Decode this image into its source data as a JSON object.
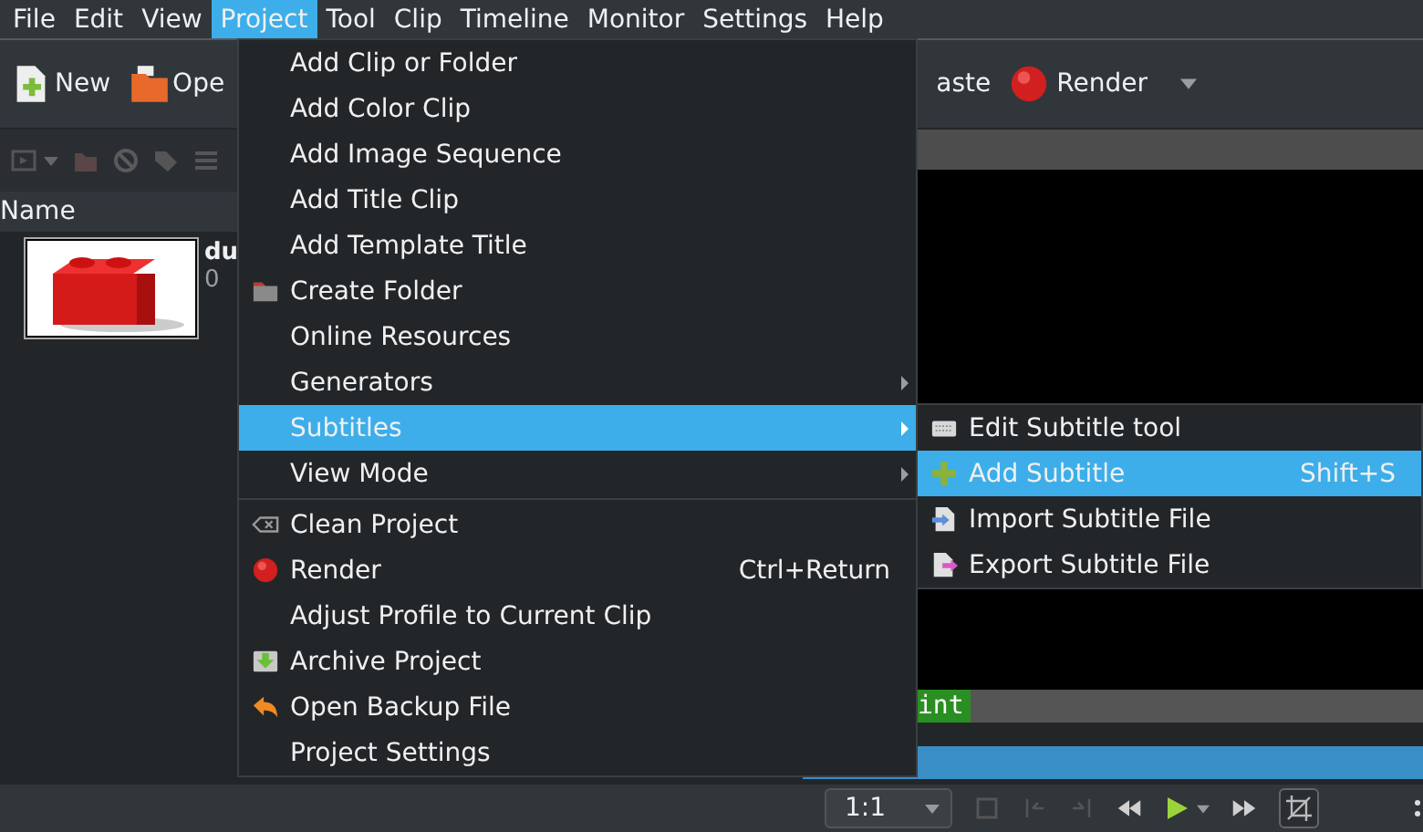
{
  "menubar": [
    {
      "label": "File",
      "selected": false
    },
    {
      "label": "Edit",
      "selected": false
    },
    {
      "label": "View",
      "selected": false
    },
    {
      "label": "Project",
      "selected": true
    },
    {
      "label": "Tool",
      "selected": false
    },
    {
      "label": "Clip",
      "selected": false
    },
    {
      "label": "Timeline",
      "selected": false
    },
    {
      "label": "Monitor",
      "selected": false
    },
    {
      "label": "Settings",
      "selected": false
    },
    {
      "label": "Help",
      "selected": false
    }
  ],
  "toolbar": [
    {
      "label": "New"
    },
    {
      "label": "Ope"
    }
  ],
  "toolbar_right": [
    {
      "label": "aste"
    },
    {
      "label": "Render",
      "dropdown": true
    }
  ],
  "bin": {
    "column_header": "Name",
    "clip": {
      "title": "du",
      "subtitle": "0"
    }
  },
  "project_menu": [
    {
      "label": "Add Clip or Folder",
      "kind": "plain",
      "selected": false
    },
    {
      "label": "Add Color Clip",
      "kind": "plain",
      "selected": false
    },
    {
      "label": "Add Image Sequence",
      "kind": "plain",
      "selected": false
    },
    {
      "label": "Add Title Clip",
      "kind": "plain",
      "selected": false
    },
    {
      "label": "Add Template Title",
      "kind": "plain",
      "selected": false
    },
    {
      "label": "Create Folder",
      "kind": "folder",
      "selected": false
    },
    {
      "label": "Online Resources",
      "kind": "plain",
      "selected": false
    },
    {
      "label": "Generators",
      "kind": "plain",
      "submenu": true,
      "selected": false
    },
    {
      "label": "Subtitles",
      "kind": "plain",
      "submenu": true,
      "selected": true
    },
    {
      "label": "View Mode",
      "kind": "plain",
      "submenu": true,
      "selected": false,
      "separator_after": true
    },
    {
      "label": "Clean Project",
      "kind": "eraser",
      "selected": false
    },
    {
      "label": "Render",
      "kind": "render",
      "shortcut": "Ctrl+Return",
      "selected": false
    },
    {
      "label": "Adjust Profile to Current Clip",
      "kind": "plain",
      "selected": false
    },
    {
      "label": "Archive Project",
      "kind": "archive",
      "selected": false
    },
    {
      "label": "Open Backup File",
      "kind": "undo",
      "selected": false
    },
    {
      "label": "Project Settings",
      "kind": "plain",
      "selected": false
    }
  ],
  "subtitles_menu": [
    {
      "label": "Edit Subtitle tool",
      "kind": "keyboard",
      "selected": false
    },
    {
      "label": "Add Subtitle",
      "kind": "plus",
      "shortcut": "Shift+S",
      "selected": true
    },
    {
      "label": "Import Subtitle File",
      "kind": "import",
      "selected": false
    },
    {
      "label": "Export Subtitle File",
      "kind": "export",
      "selected": false
    }
  ],
  "timeline": {
    "clip_label": "int"
  },
  "monitor_toolbar": {
    "zoom": "1:1"
  }
}
